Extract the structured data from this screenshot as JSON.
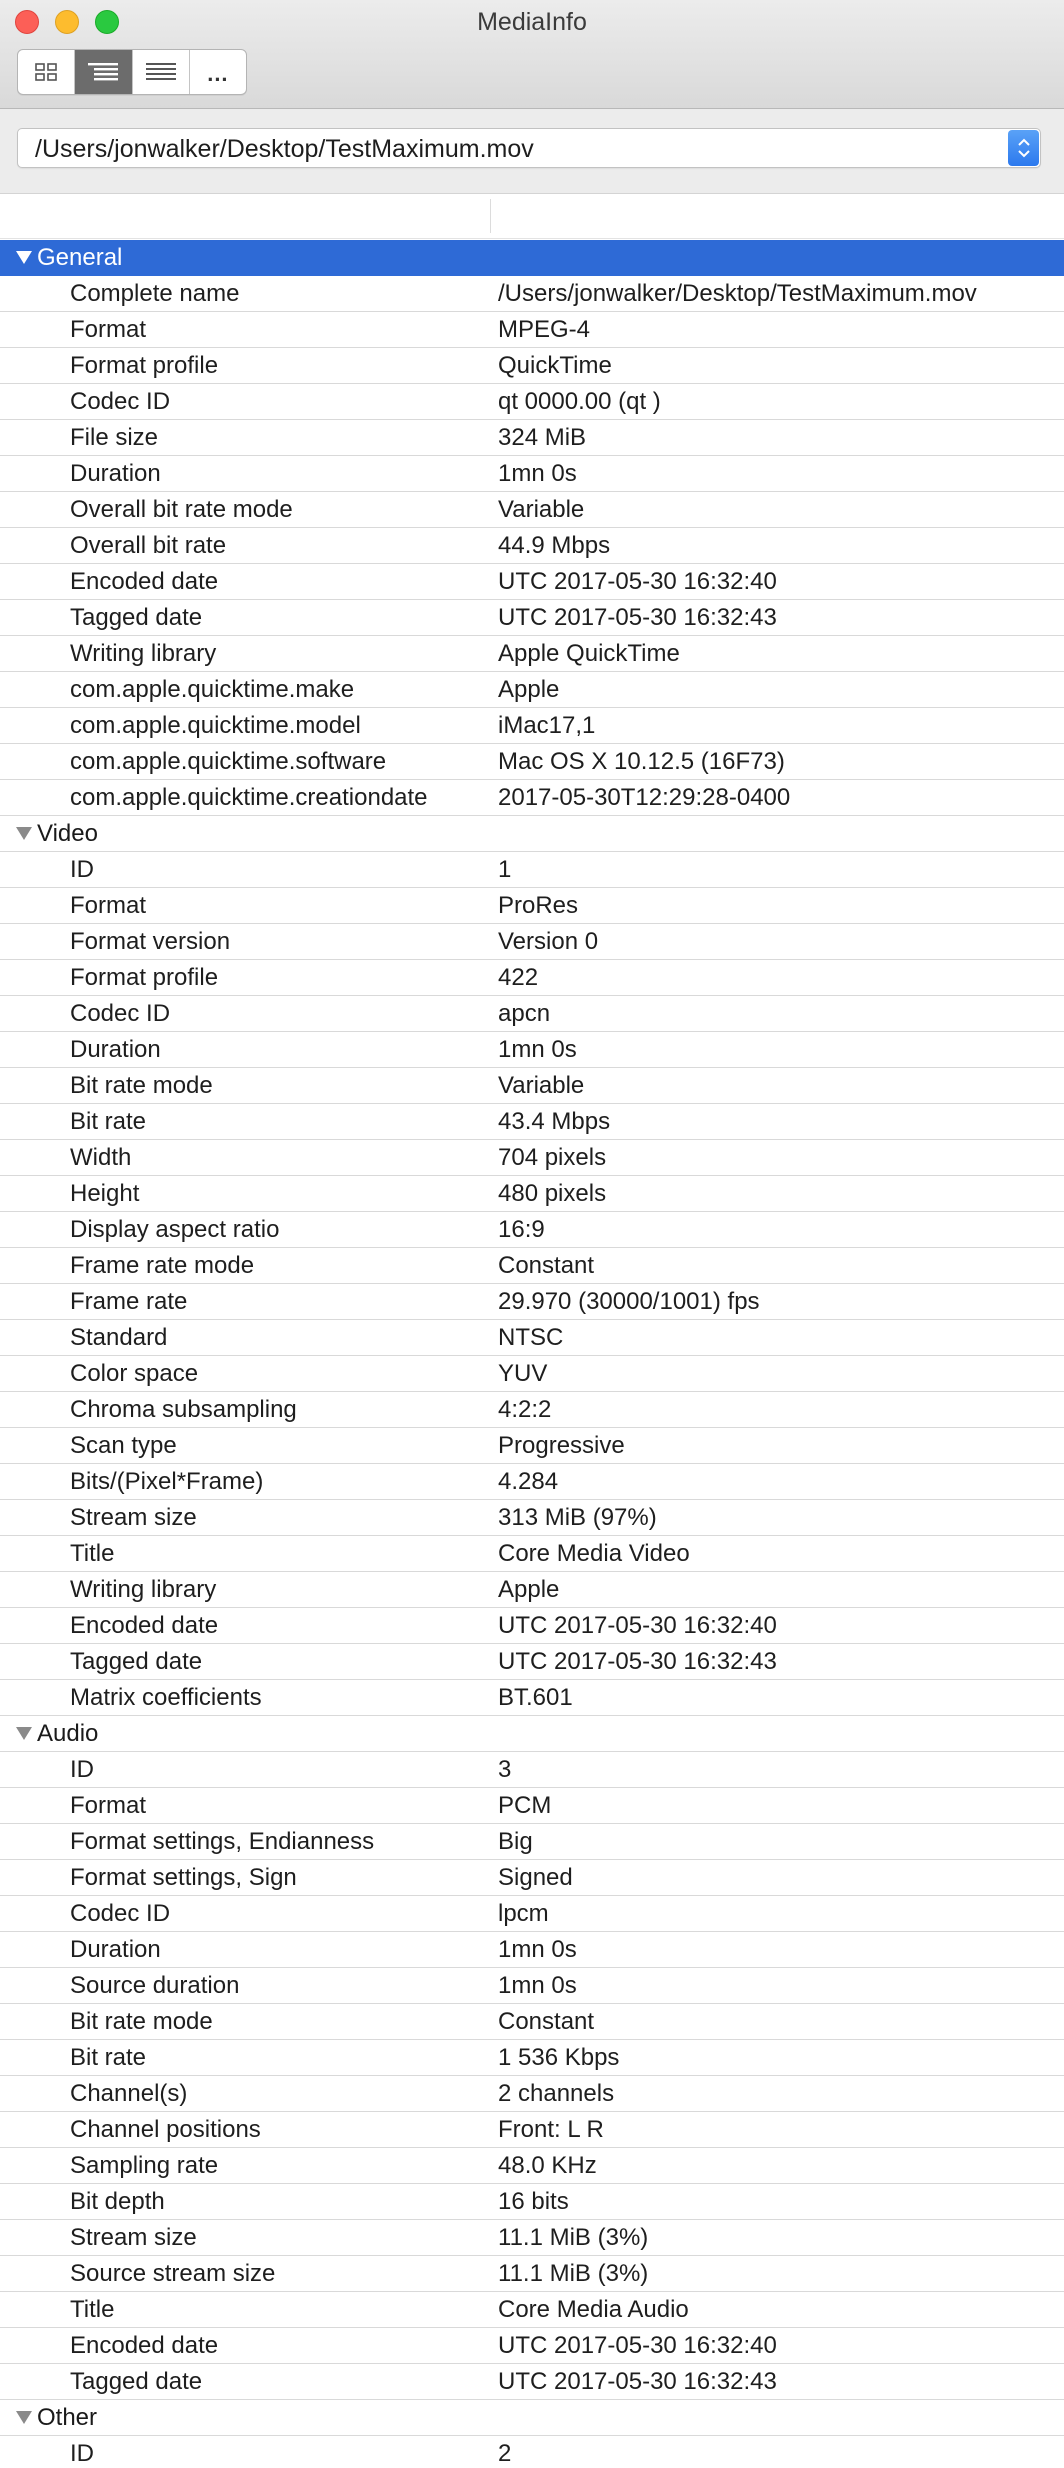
{
  "window": {
    "title": "MediaInfo"
  },
  "toolbar": {
    "buttons": [
      {
        "name": "view-basic",
        "icon": "grid-icon",
        "active": false
      },
      {
        "name": "view-sheet",
        "icon": "outline-list-icon",
        "active": true
      },
      {
        "name": "view-text",
        "icon": "text-lines-icon",
        "active": false
      },
      {
        "name": "view-more",
        "label": "...",
        "active": false
      }
    ]
  },
  "file": {
    "path": "/Users/jonwalker/Desktop/TestMaximum.mov"
  },
  "colors": {
    "selection": "#2e6ad6",
    "stepper": "#2c79ee",
    "close": "#fc5f57",
    "minimize": "#fdbc2e",
    "zoom": "#2ac940"
  },
  "sections": [
    {
      "name": "General",
      "selected": true,
      "props": [
        [
          "Complete name",
          "/Users/jonwalker/Desktop/TestMaximum.mov"
        ],
        [
          "Format",
          "MPEG-4"
        ],
        [
          "Format profile",
          "QuickTime"
        ],
        [
          "Codec ID",
          "qt   0000.00 (qt  )"
        ],
        [
          "File size",
          "324 MiB"
        ],
        [
          "Duration",
          "1mn 0s"
        ],
        [
          "Overall bit rate mode",
          "Variable"
        ],
        [
          "Overall bit rate",
          "44.9 Mbps"
        ],
        [
          "Encoded date",
          "UTC 2017-05-30 16:32:40"
        ],
        [
          "Tagged date",
          "UTC 2017-05-30 16:32:43"
        ],
        [
          "Writing library",
          "Apple QuickTime"
        ],
        [
          "com.apple.quicktime.make",
          "Apple"
        ],
        [
          "com.apple.quicktime.model",
          "iMac17,1"
        ],
        [
          "com.apple.quicktime.software",
          "Mac OS X 10.12.5 (16F73)"
        ],
        [
          "com.apple.quicktime.creationdate",
          "2017-05-30T12:29:28-0400"
        ]
      ]
    },
    {
      "name": "Video",
      "selected": false,
      "props": [
        [
          "ID",
          "1"
        ],
        [
          "Format",
          "ProRes"
        ],
        [
          "Format version",
          "Version 0"
        ],
        [
          "Format profile",
          "422"
        ],
        [
          "Codec ID",
          "apcn"
        ],
        [
          "Duration",
          "1mn 0s"
        ],
        [
          "Bit rate mode",
          "Variable"
        ],
        [
          "Bit rate",
          "43.4 Mbps"
        ],
        [
          "Width",
          "704 pixels"
        ],
        [
          "Height",
          "480 pixels"
        ],
        [
          "Display aspect ratio",
          "16:9"
        ],
        [
          "Frame rate mode",
          "Constant"
        ],
        [
          "Frame rate",
          "29.970 (30000/1001) fps"
        ],
        [
          "Standard",
          "NTSC"
        ],
        [
          "Color space",
          "YUV"
        ],
        [
          "Chroma subsampling",
          "4:2:2"
        ],
        [
          "Scan type",
          "Progressive"
        ],
        [
          "Bits/(Pixel*Frame)",
          "4.284"
        ],
        [
          "Stream size",
          "313 MiB (97%)"
        ],
        [
          "Title",
          "Core Media Video"
        ],
        [
          "Writing library",
          "Apple"
        ],
        [
          "Encoded date",
          "UTC 2017-05-30 16:32:40"
        ],
        [
          "Tagged date",
          "UTC 2017-05-30 16:32:43"
        ],
        [
          "Matrix coefficients",
          "BT.601"
        ]
      ]
    },
    {
      "name": "Audio",
      "selected": false,
      "props": [
        [
          "ID",
          "3"
        ],
        [
          "Format",
          "PCM"
        ],
        [
          "Format settings, Endianness",
          "Big"
        ],
        [
          "Format settings, Sign",
          "Signed"
        ],
        [
          "Codec ID",
          "lpcm"
        ],
        [
          "Duration",
          "1mn 0s"
        ],
        [
          "Source duration",
          "1mn 0s"
        ],
        [
          "Bit rate mode",
          "Constant"
        ],
        [
          "Bit rate",
          "1 536 Kbps"
        ],
        [
          "Channel(s)",
          "2 channels"
        ],
        [
          "Channel positions",
          "Front: L R"
        ],
        [
          "Sampling rate",
          "48.0 KHz"
        ],
        [
          "Bit depth",
          "16 bits"
        ],
        [
          "Stream size",
          "11.1 MiB (3%)"
        ],
        [
          "Source stream size",
          "11.1 MiB (3%)"
        ],
        [
          "Title",
          "Core Media Audio"
        ],
        [
          "Encoded date",
          "UTC 2017-05-30 16:32:40"
        ],
        [
          "Tagged date",
          "UTC 2017-05-30 16:32:43"
        ]
      ]
    },
    {
      "name": "Other",
      "selected": false,
      "props": [
        [
          "ID",
          "2"
        ]
      ]
    }
  ]
}
